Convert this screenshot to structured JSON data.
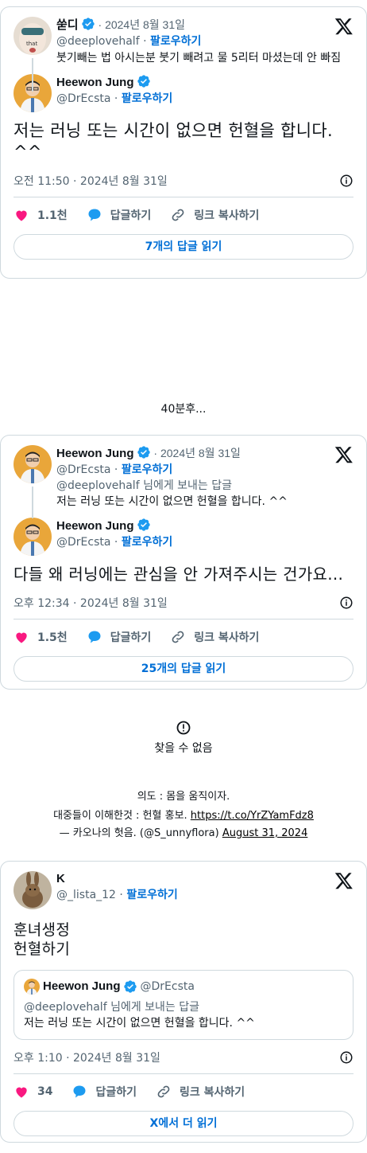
{
  "tweet1": {
    "parent": {
      "name": "쑫디",
      "date": "2024년 8월 31일",
      "handle": "@deeplovehalf",
      "follow": "팔로우하기",
      "text": "붓기빼는 법 아시는분 붓기 빼려고 물 5리터 마셨는데 안 빠짐"
    },
    "main": {
      "name": "Heewon Jung",
      "handle": "@DrEcsta",
      "follow": "팔로우하기",
      "text": "저는 러닝 또는 시간이 없으면 헌혈을 합니다. ^^",
      "datetime": "오전 11:50 · 2024년 8월 31일",
      "likes": "1.1천",
      "reply": "답글하기",
      "copy_link": "링크 복사하기",
      "read_replies": "7개의 답글 읽기"
    }
  },
  "caption_40min": "40분후...",
  "tweet2": {
    "parent": {
      "name": "Heewon Jung",
      "date": "2024년 8월 31일",
      "handle": "@DrEcsta",
      "follow": "팔로우하기",
      "reply_to_handle": "@deeplovehalf",
      "reply_to_suffix": " 님에게 보내는 답글",
      "text": "저는 러닝 또는 시간이 없으면 헌혈을 합니다. ^^"
    },
    "main": {
      "name": "Heewon Jung",
      "handle": "@DrEcsta",
      "follow": "팔로우하기",
      "text": "다들 왜 러닝에는 관심을 안 가져주시는 건가요...",
      "datetime": "오후 12:34 · 2024년 8월 31일",
      "likes": "1.5천",
      "reply": "답글하기",
      "copy_link": "링크 복사하기",
      "read_replies": "25개의 답글 읽기"
    }
  },
  "not_found": {
    "text": "찾을 수 없음"
  },
  "embedded_text": {
    "line1": "의도 : 몸을 움직이자.",
    "line2_prefix": "대중들이 이해한것 : 헌혈 홍보. ",
    "line2_link": "https://t.co/YrZYamFdz8",
    "line3_prefix": "— 카오나의 헛음. (@S_unnyflora) ",
    "line3_link": "August 31, 2024"
  },
  "tweet3": {
    "name": "K",
    "handle": "@_lista_12",
    "follow": "팔로우하기",
    "text_line1": "훈녀생정",
    "text_line2": "헌혈하기",
    "quote": {
      "name": "Heewon Jung",
      "handle": "@DrEcsta",
      "reply_to_handle": "@deeplovehalf",
      "reply_to_suffix": " 님에게 보내는 답글",
      "text": "저는 러닝 또는 시간이 없으면 헌혈을 합니다. ^^"
    },
    "datetime": "오후 1:10 · 2024년 8월 31일",
    "likes": "34",
    "reply": "답글하기",
    "copy_link": "링크 복사하기",
    "read_more": "X에서 더 읽기"
  },
  "colors": {
    "accent": "#006fd6",
    "verified": "#1d9bf0",
    "heart": "#f91880",
    "reply_bubble": "#1d9bf0",
    "border": "#cfd9de",
    "muted": "#536471"
  }
}
